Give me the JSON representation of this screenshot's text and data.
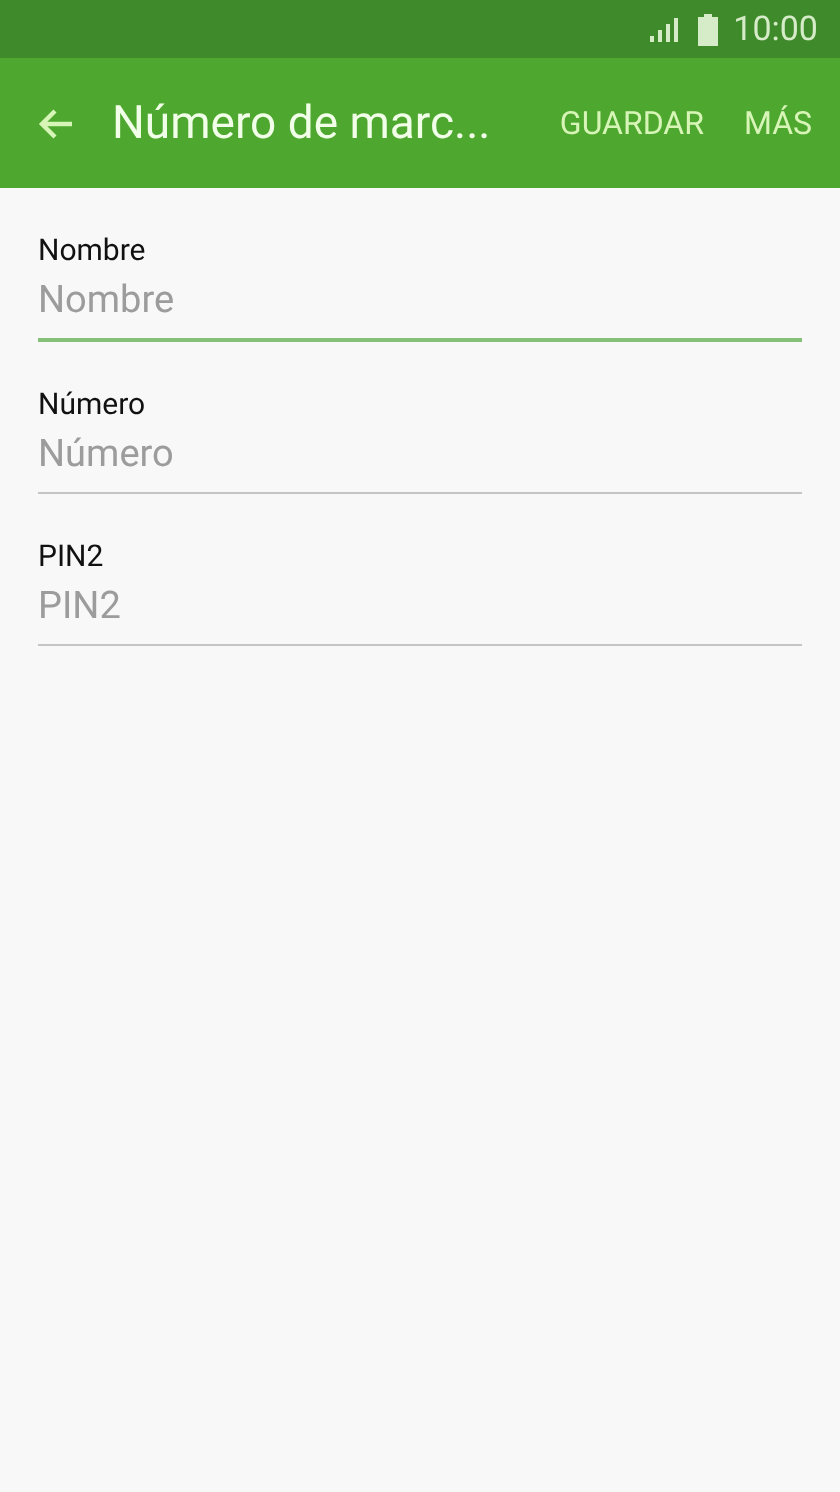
{
  "status_bar": {
    "time": "10:00"
  },
  "app_bar": {
    "title": "Número de marc...",
    "actions": [
      "GUARDAR",
      "MÁS"
    ]
  },
  "fields": [
    {
      "label": "Nombre",
      "placeholder": "Nombre",
      "focused": true
    },
    {
      "label": "Número",
      "placeholder": "Número",
      "focused": false
    },
    {
      "label": "PIN2",
      "placeholder": "PIN2",
      "focused": false
    }
  ]
}
